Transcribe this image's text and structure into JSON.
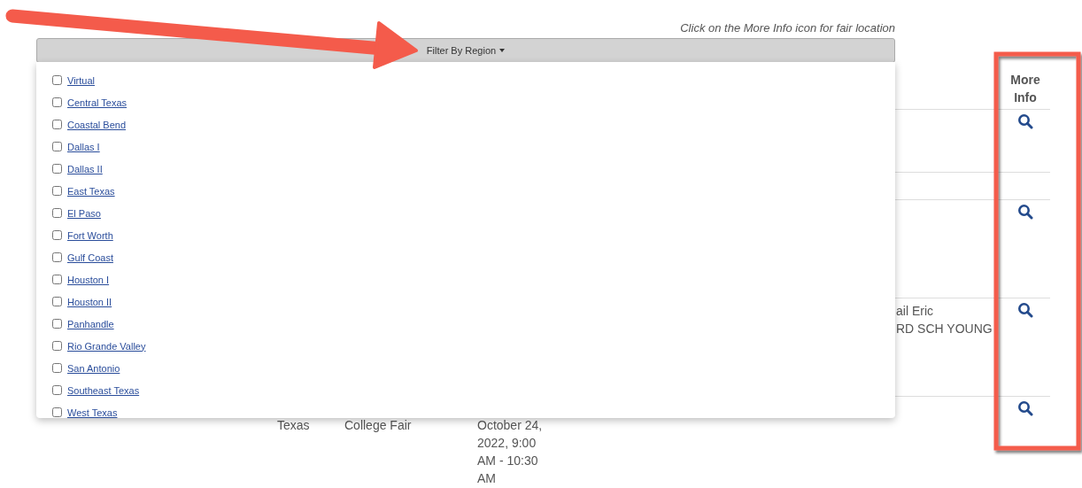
{
  "note": "Click on the More Info icon for fair location",
  "filter": {
    "label": "Filter By Region",
    "expanded": true,
    "regions": [
      {
        "label": "Virtual",
        "checked": false
      },
      {
        "label": "Central Texas",
        "checked": false
      },
      {
        "label": "Coastal Bend",
        "checked": false
      },
      {
        "label": "Dallas I",
        "checked": false
      },
      {
        "label": "Dallas II",
        "checked": false
      },
      {
        "label": "East Texas",
        "checked": false
      },
      {
        "label": "El Paso",
        "checked": false
      },
      {
        "label": "Fort Worth",
        "checked": false
      },
      {
        "label": "Gulf Coast",
        "checked": false
      },
      {
        "label": "Houston I",
        "checked": false
      },
      {
        "label": "Houston II",
        "checked": false
      },
      {
        "label": "Panhandle",
        "checked": false
      },
      {
        "label": "Rio Grande Valley",
        "checked": false
      },
      {
        "label": "San Antonio",
        "checked": false
      },
      {
        "label": "Southeast Texas",
        "checked": false
      },
      {
        "label": "West Texas",
        "checked": false
      }
    ]
  },
  "table": {
    "more_info_header": "More Info",
    "rows": [
      {
        "cells": {},
        "info_icon": true
      },
      {
        "cells": {},
        "info_icon": false
      },
      {
        "cells": {},
        "info_icon": true
      },
      {
        "cells": {
          "column_6": "ail Eric\nRD SCH YOUNG"
        },
        "info_icon": true
      },
      {
        "cells": {
          "column_2": "Texas",
          "column_3": "College Fair",
          "column_4": "October 24, 2022, 9:00 AM - 10:30 AM"
        },
        "info_icon": true
      }
    ]
  }
}
